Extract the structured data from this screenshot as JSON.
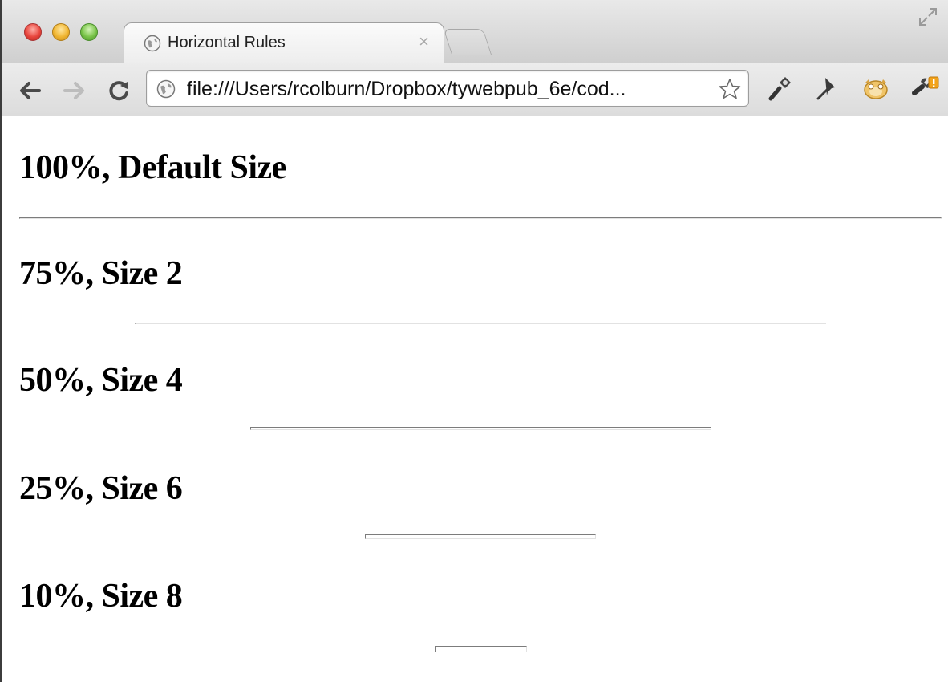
{
  "browser": {
    "tab_title": "Horizontal Rules",
    "tab_close": "×",
    "url": "file:///Users/rcolburn/Dropbox/tywebpub_6e/cod..."
  },
  "page": {
    "rules": [
      {
        "heading": "100%, Default Size",
        "width_percent": 100,
        "size": 2
      },
      {
        "heading": "75%, Size 2",
        "width_percent": 75,
        "size": 2
      },
      {
        "heading": "50%, Size 4",
        "width_percent": 50,
        "size": 4
      },
      {
        "heading": "25%, Size 6",
        "width_percent": 25,
        "size": 6
      },
      {
        "heading": "10%, Size 8",
        "width_percent": 10,
        "size": 8
      }
    ]
  },
  "colors": {
    "rule_shadow": "#7c7c7c",
    "rule_highlight": "#e2e2e2"
  }
}
